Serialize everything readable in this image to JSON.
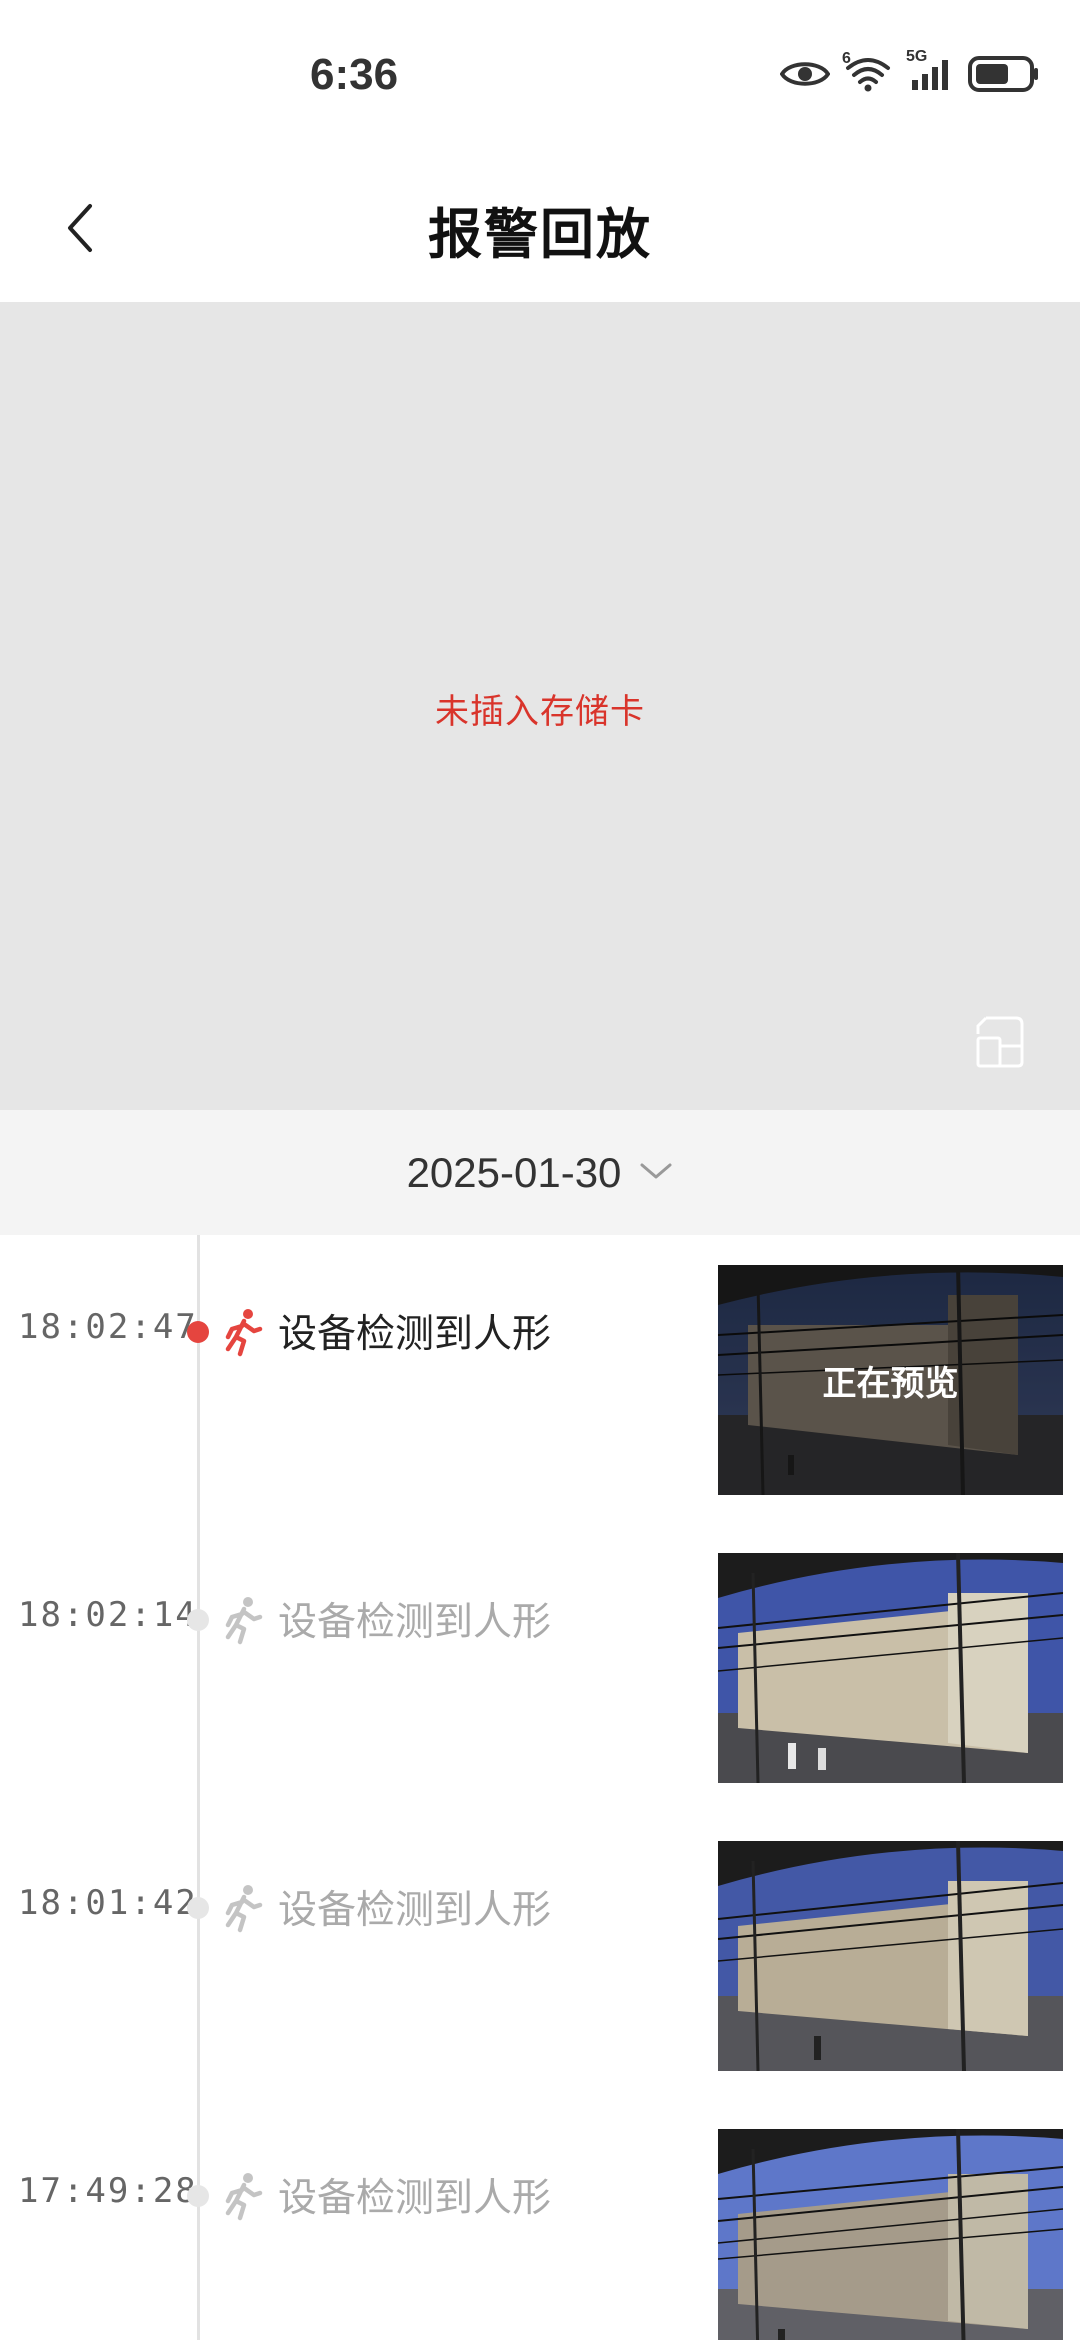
{
  "status_bar": {
    "time": "6:36",
    "icons": [
      "eye-icon",
      "wifi-icon",
      "signal-5g-icon",
      "battery-icon"
    ],
    "wifi_label": "6",
    "network_label": "5G"
  },
  "header": {
    "title": "报警回放",
    "back_icon": "chevron-left-icon"
  },
  "video": {
    "message": "未插入存储卡",
    "message_color": "#d9342b",
    "screenshot_icon": "screenshot-icon"
  },
  "date_picker": {
    "date": "2025-01-30",
    "icon": "chevron-down-icon"
  },
  "events": [
    {
      "time": "18:02:47",
      "label": "设备检测到人形",
      "active": true,
      "overlay": "正在预览",
      "icon": "person-walking-icon"
    },
    {
      "time": "18:02:14",
      "label": "设备检测到人形",
      "active": false,
      "icon": "person-walking-icon"
    },
    {
      "time": "18:01:42",
      "label": "设备检测到人形",
      "active": false,
      "icon": "person-walking-icon"
    },
    {
      "time": "17:49:28",
      "label": "设备检测到人形",
      "active": false,
      "icon": "person-walking-icon"
    }
  ],
  "colors": {
    "accent": "#e5453f",
    "inactive_icon": "#c4c4c4",
    "video_bg": "#e6e6e6"
  }
}
